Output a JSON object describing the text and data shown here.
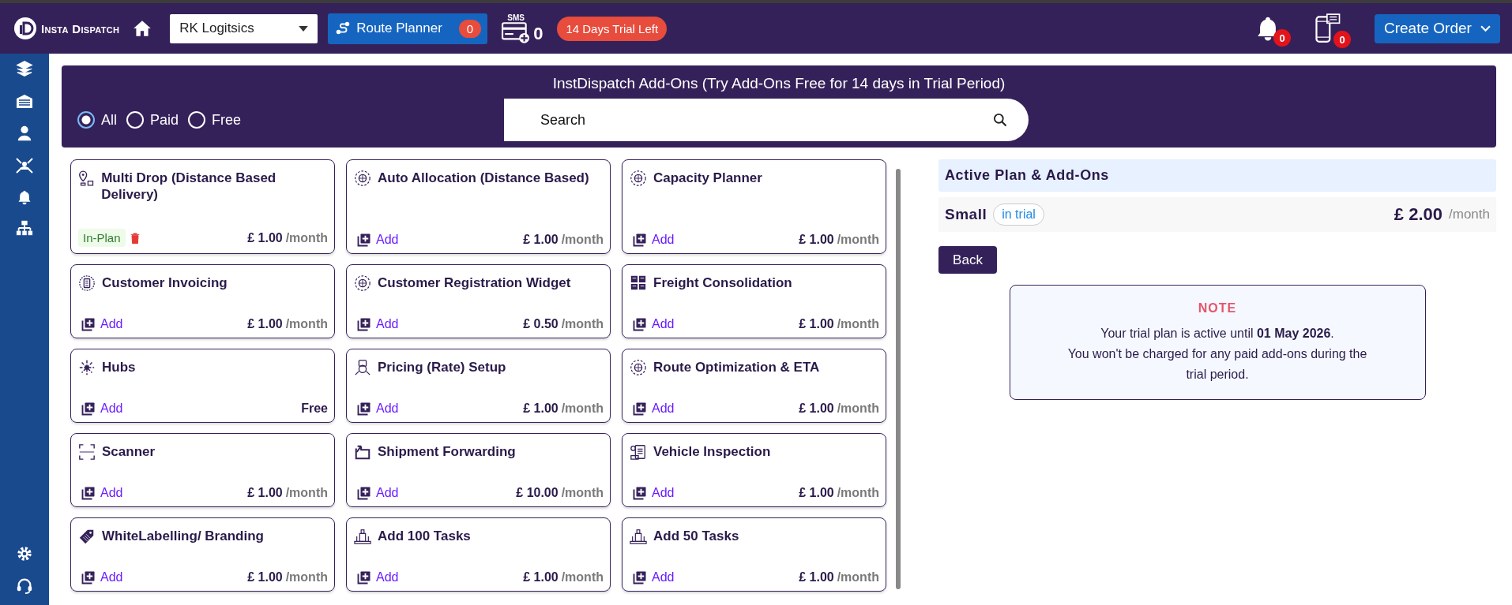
{
  "navbar": {
    "brand": "Insta Dispatch",
    "company_select": {
      "value": "RK Logitsics"
    },
    "route_planner": {
      "label": "Route Planner",
      "count": "0"
    },
    "sms": {
      "label": "SMS",
      "count": "0"
    },
    "trial_badge": "14 Days Trial Left",
    "notifications_count": "0",
    "messages_count": "0",
    "create_order": "Create Order"
  },
  "addons_header": {
    "title": "InstDispatch Add-Ons (Try Add-Ons Free for 14 days in Trial Period)",
    "filters": [
      {
        "label": "All",
        "selected": true
      },
      {
        "label": "Paid",
        "selected": false
      },
      {
        "label": "Free",
        "selected": false
      }
    ],
    "search": {
      "placeholder": "Search"
    }
  },
  "addons": [
    {
      "name": "Multi Drop (Distance Based Delivery)",
      "kind": "in_plan",
      "action": "In-Plan",
      "price": "£ 1.00",
      "period": "/month"
    },
    {
      "name": "Auto Allocation (Distance Based)",
      "kind": "add",
      "action": "Add",
      "price": "£ 1.00",
      "period": "/month"
    },
    {
      "name": "Capacity Planner",
      "kind": "add",
      "action": "Add",
      "price": "£ 1.00",
      "period": "/month"
    },
    {
      "name": "Customer Invoicing",
      "kind": "add",
      "action": "Add",
      "price": "£ 1.00",
      "period": "/month"
    },
    {
      "name": "Customer Registration Widget",
      "kind": "add",
      "action": "Add",
      "price": "£ 0.50",
      "period": "/month"
    },
    {
      "name": "Freight Consolidation",
      "kind": "add",
      "action": "Add",
      "price": "£ 1.00",
      "period": "/month"
    },
    {
      "name": "Hubs",
      "kind": "add",
      "action": "Add",
      "price": "Free"
    },
    {
      "name": "Pricing (Rate) Setup",
      "kind": "add",
      "action": "Add",
      "price": "£ 1.00",
      "period": "/month"
    },
    {
      "name": "Route Optimization & ETA",
      "kind": "add",
      "action": "Add",
      "price": "£ 1.00",
      "period": "/month"
    },
    {
      "name": "Scanner",
      "kind": "add",
      "action": "Add",
      "price": "£ 1.00",
      "period": "/month"
    },
    {
      "name": "Shipment Forwarding",
      "kind": "add",
      "action": "Add",
      "price": "£ 10.00",
      "period": "/month"
    },
    {
      "name": "Vehicle Inspection",
      "kind": "add",
      "action": "Add",
      "price": "£ 1.00",
      "period": "/month"
    },
    {
      "name": "WhiteLabelling/ Branding",
      "kind": "add",
      "action": "Add",
      "price": "£ 1.00",
      "period": "/month"
    },
    {
      "name": "Add 100 Tasks",
      "kind": "add",
      "action": "Add",
      "price": "£ 1.00",
      "period": "/month"
    },
    {
      "name": "Add 50 Tasks",
      "kind": "add",
      "action": "Add",
      "price": "£ 1.00",
      "period": "/month"
    }
  ],
  "active_plan": {
    "title": "Active Plan & Add-Ons",
    "plan": "Small",
    "status_badge": "in trial",
    "price": "£ 2.00",
    "period": "/month"
  },
  "back_button": "Back",
  "note": {
    "title": "NOTE",
    "lines": [
      "Your trial plan is active until **01 May 2026**.",
      "You won't be charged for any paid add-ons during the trial period."
    ]
  }
}
